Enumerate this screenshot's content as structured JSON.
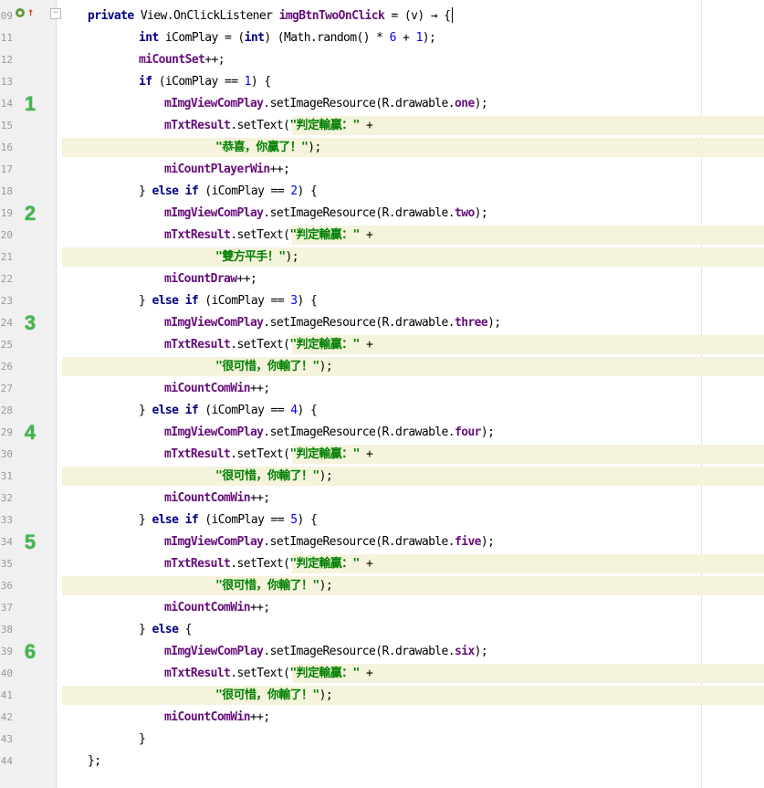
{
  "line_numbers": [
    "09",
    "11",
    "12",
    "13",
    "14",
    "15",
    "16",
    "17",
    "18",
    "19",
    "20",
    "21",
    "22",
    "23",
    "24",
    "25",
    "26",
    "27",
    "28",
    "29",
    "30",
    "31",
    "32",
    "33",
    "34",
    "35",
    "36",
    "37",
    "38",
    "39",
    "40",
    "41",
    "42",
    "43",
    "44"
  ],
  "markers": [
    "1",
    "2",
    "3",
    "4",
    "5",
    "6"
  ],
  "icons": {
    "run": "run-gutter-icon",
    "override": "override-arrow-icon",
    "fold": "fold-icon"
  },
  "colors": {
    "keyword": "#000080",
    "field": "#660e7a",
    "string": "#008000",
    "number": "#0000ff",
    "highlight": "#f5f3dc",
    "marker": "#42b84c"
  },
  "lines": [
    [
      "private",
      " View.OnClickListener ",
      "imgBtnTwoOnClick",
      " = (v) → {"
    ],
    [
      "int",
      " iComPlay = (",
      "int",
      ") (Math.random() * ",
      "6",
      " + ",
      "1",
      ");"
    ],
    [
      "miCountSet",
      "++;"
    ],
    [
      "if",
      " (iComPlay == ",
      "1",
      ") {"
    ],
    [
      "mImgViewComPlay",
      ".setImageResource(R.drawable.",
      "one",
      ");"
    ],
    [
      "mTxtResult",
      ".setText(",
      "\"判定輸贏：\"",
      " +"
    ],
    [
      "\"恭喜，你贏了！\"",
      ");"
    ],
    [
      "miCountPlayerWin",
      "++;"
    ],
    [
      "} ",
      "else if",
      " (iComPlay == ",
      "2",
      ") {"
    ],
    [
      "mImgViewComPlay",
      ".setImageResource(R.drawable.",
      "two",
      ");"
    ],
    [
      "mTxtResult",
      ".setText(",
      "\"判定輸贏：\"",
      " +"
    ],
    [
      "\"雙方平手！\"",
      ");"
    ],
    [
      "miCountDraw",
      "++;"
    ],
    [
      "} ",
      "else if",
      " (iComPlay == ",
      "3",
      ") {"
    ],
    [
      "mImgViewComPlay",
      ".setImageResource(R.drawable.",
      "three",
      ");"
    ],
    [
      "mTxtResult",
      ".setText(",
      "\"判定輸贏：\"",
      " +"
    ],
    [
      "\"很可惜，你輸了！\"",
      ");"
    ],
    [
      "miCountComWin",
      "++;"
    ],
    [
      "} ",
      "else if",
      " (iComPlay == ",
      "4",
      ") {"
    ],
    [
      "mImgViewComPlay",
      ".setImageResource(R.drawable.",
      "four",
      ");"
    ],
    [
      "mTxtResult",
      ".setText(",
      "\"判定輸贏：\"",
      " +"
    ],
    [
      "\"很可惜，你輸了！\"",
      ");"
    ],
    [
      "miCountComWin",
      "++;"
    ],
    [
      "} ",
      "else if",
      " (iComPlay == ",
      "5",
      ") {"
    ],
    [
      "mImgViewComPlay",
      ".setImageResource(R.drawable.",
      "five",
      ");"
    ],
    [
      "mTxtResult",
      ".setText(",
      "\"判定輸贏：\"",
      " +"
    ],
    [
      "\"很可惜，你輸了！\"",
      ");"
    ],
    [
      "miCountComWin",
      "++;"
    ],
    [
      "} ",
      "else",
      " {"
    ],
    [
      "mImgViewComPlay",
      ".setImageResource(R.drawable.",
      "six",
      ");"
    ],
    [
      "mTxtResult",
      ".setText(",
      "\"判定輸贏：\"",
      " +"
    ],
    [
      "\"很可惜，你輸了！\"",
      ");"
    ],
    [
      "miCountComWin",
      "++;"
    ],
    [
      "}"
    ],
    [
      "};"
    ]
  ]
}
